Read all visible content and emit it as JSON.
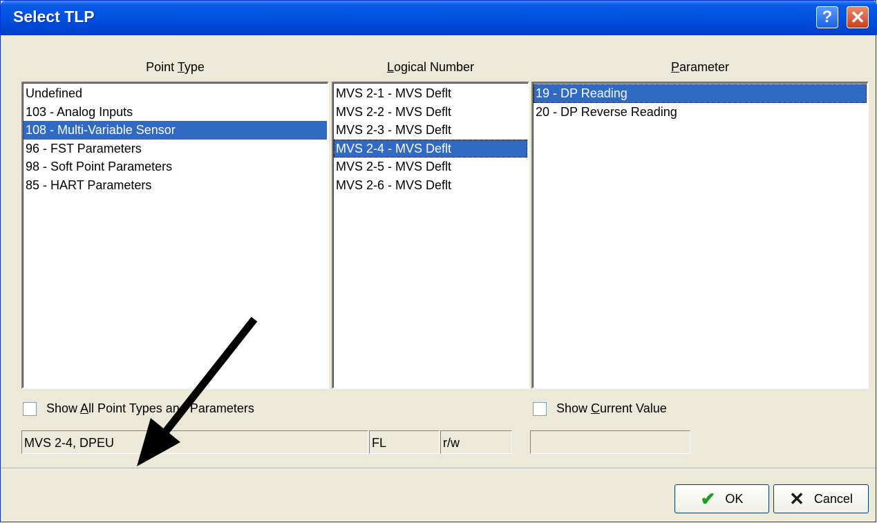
{
  "window": {
    "title": "Select TLP",
    "help_label": "?",
    "close_label": "✕"
  },
  "columns": {
    "point_type": {
      "header_pre": "Point ",
      "header_acc": "T",
      "header_post": "ype",
      "items": [
        "Undefined",
        "103 - Analog Inputs",
        "108 - Multi-Variable Sensor",
        "96 - FST Parameters",
        "98 - Soft Point Parameters",
        "85 - HART Parameters"
      ],
      "selected_index": 2
    },
    "logical_number": {
      "header_pre": "",
      "header_acc": "L",
      "header_post": "ogical Number",
      "items": [
        "MVS 2-1 - MVS Deflt",
        "MVS 2-2 - MVS Deflt",
        "MVS 2-3 - MVS Deflt",
        "MVS 2-4 - MVS Deflt",
        "MVS 2-5 - MVS Deflt",
        "MVS 2-6 - MVS Deflt"
      ],
      "selected_index": 3
    },
    "parameter": {
      "header_pre": "",
      "header_acc": "P",
      "header_post": "arameter",
      "items": [
        "19 - DP Reading",
        "20 - DP Reverse Reading"
      ],
      "selected_index": 0
    }
  },
  "options": {
    "show_all": {
      "pre": "Show ",
      "acc": "A",
      "post": "ll Point Types and Parameters",
      "checked": false
    },
    "show_current": {
      "pre": "Show ",
      "acc": "C",
      "post": "urrent Value",
      "checked": false
    }
  },
  "status": {
    "tlp": "MVS 2-4, DPEU",
    "type": "FL",
    "access": "r/w",
    "current_value": ""
  },
  "buttons": {
    "ok_label": "OK",
    "cancel_label": "Cancel"
  },
  "colors": {
    "selection": "#316ac5",
    "dialog_bg": "#ece9d8",
    "title_bar": "#0054e3"
  }
}
